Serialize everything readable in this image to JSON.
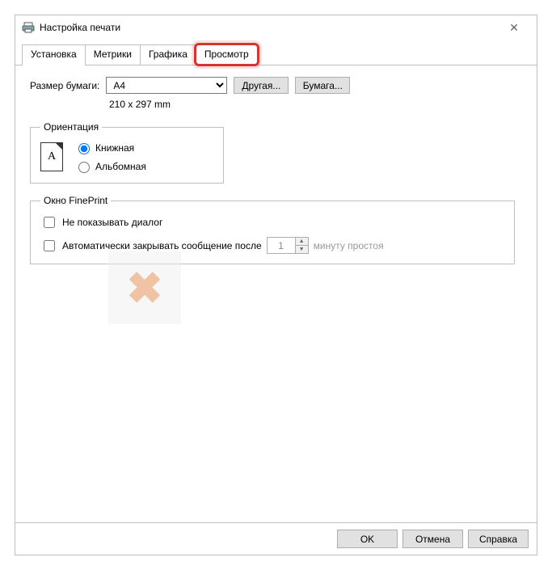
{
  "window": {
    "title": "Настройка печати"
  },
  "tabs": [
    {
      "label": "Установка"
    },
    {
      "label": "Метрики"
    },
    {
      "label": "Графика"
    },
    {
      "label": "Просмотр"
    }
  ],
  "paper": {
    "label": "Размер бумаги:",
    "selected": "A4",
    "dimensions": "210 x 297 mm",
    "other_btn": "Другая...",
    "paper_btn": "Бумага..."
  },
  "orientation": {
    "legend": "Ориентация",
    "portrait": "Книжная",
    "landscape": "Альбомная",
    "icon_letter": "A"
  },
  "fineprint": {
    "legend": "Окно FinePrint",
    "no_dialog": "Не показывать диалог",
    "auto_close": "Автоматически закрывать сообщение после",
    "minutes_value": "1",
    "minutes_suffix": "минуту простоя"
  },
  "footer": {
    "ok": "OK",
    "cancel": "Отмена",
    "help": "Справка"
  }
}
